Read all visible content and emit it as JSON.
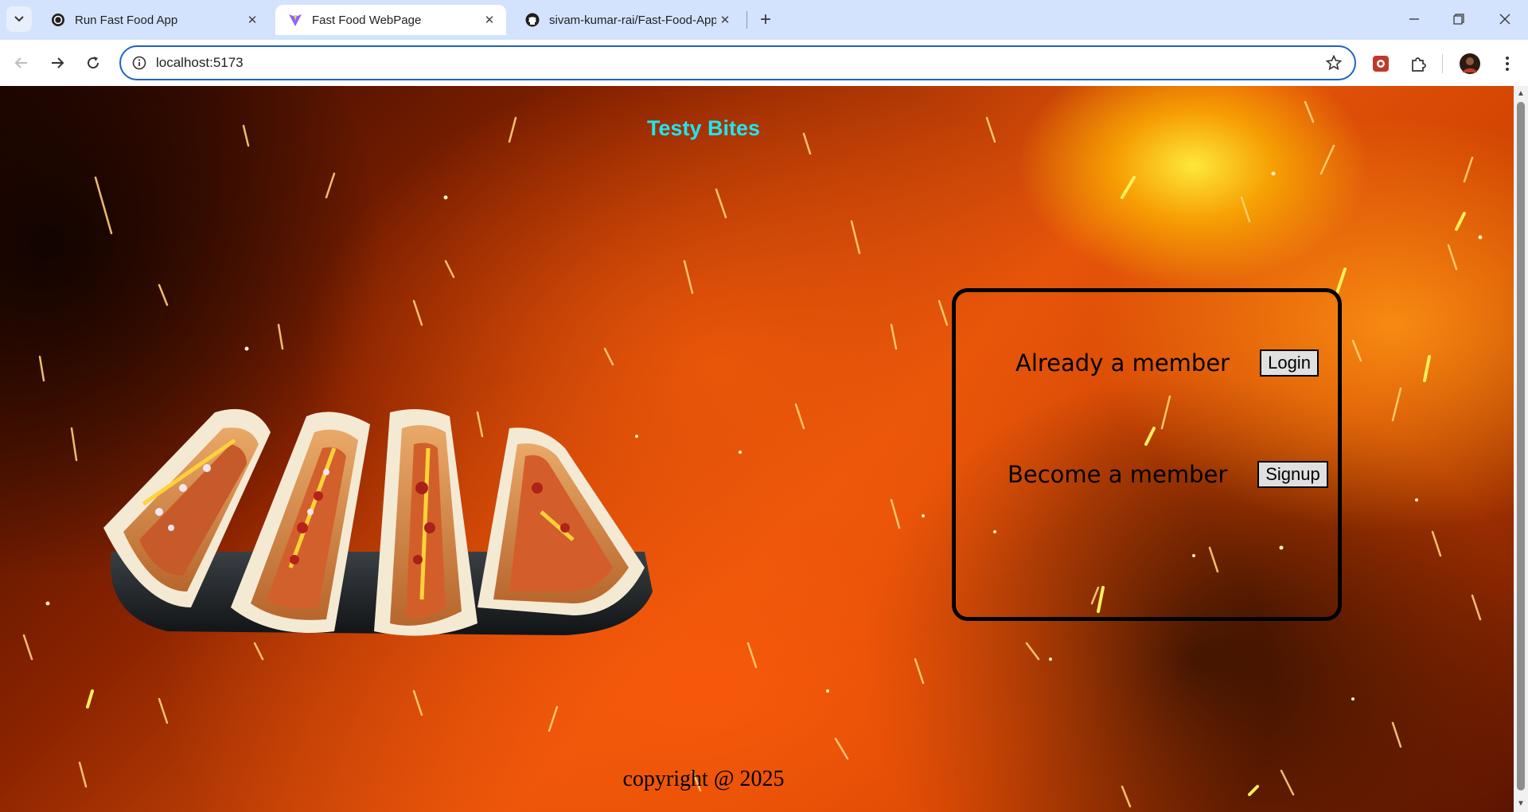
{
  "browser": {
    "tabs": [
      {
        "title": "Run Fast Food App",
        "icon": "openai-icon",
        "active": false
      },
      {
        "title": "Fast Food WebPage",
        "icon": "vite-icon",
        "active": true
      },
      {
        "title": "sivam-kumar-rai/Fast-Food-App",
        "icon": "github-icon",
        "active": false
      }
    ],
    "url": "localhost:5173"
  },
  "page": {
    "title": "Testy Bites",
    "food_image": "hot-dogs-tray-image",
    "login_prompt": "Already a member",
    "login_button": "Login",
    "signup_prompt": "Become a member",
    "signup_button": "Signup",
    "footer": "copyright @ 2025"
  },
  "colors": {
    "title": "#1fe6ee",
    "accent": "#1f62c7"
  }
}
